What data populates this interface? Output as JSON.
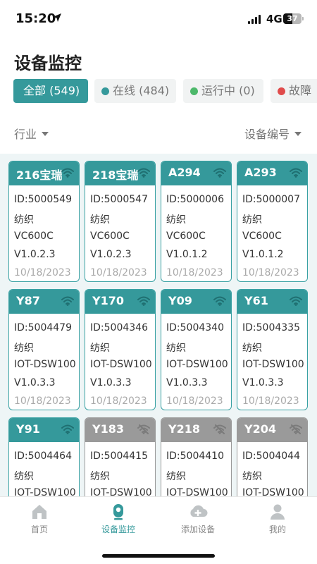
{
  "status_bar": {
    "time": "15:20",
    "network": "4G",
    "battery": "37"
  },
  "page_title": "设备监控",
  "filters": [
    {
      "label": "全部 (549)",
      "active": true,
      "dot_color": ""
    },
    {
      "label": "在线 (484)",
      "active": false,
      "dot_color": "#35999b"
    },
    {
      "label": "运行中 (0)",
      "active": false,
      "dot_color": "#4cb86a"
    },
    {
      "label": "故障",
      "active": false,
      "dot_color": "#e04b4b"
    }
  ],
  "sort": {
    "left_label": "行业",
    "right_label": "设备编号"
  },
  "devices": [
    {
      "name": "216宝瑞",
      "id": "ID:5000549",
      "industry": "纺织",
      "model": "VC600C",
      "version": "V1.0.2.3",
      "date": "10/18/2023",
      "online": true
    },
    {
      "name": "218宝瑞",
      "id": "ID:5000547",
      "industry": "纺织",
      "model": "VC600C",
      "version": "V1.0.2.3",
      "date": "10/18/2023",
      "online": true
    },
    {
      "name": "A294",
      "id": "ID:5000006",
      "industry": "纺织",
      "model": "VC600C",
      "version": "V1.0.1.2",
      "date": "10/18/2023",
      "online": true
    },
    {
      "name": "A293",
      "id": "ID:5000007",
      "industry": "纺织",
      "model": "VC600C",
      "version": "V1.0.1.2",
      "date": "10/18/2023",
      "online": true
    },
    {
      "name": "Y87",
      "id": "ID:5004479",
      "industry": "纺织",
      "model": "IOT-DSW100",
      "version": "V1.0.3.3",
      "date": "10/18/2023",
      "online": true
    },
    {
      "name": "Y170",
      "id": "ID:5004346",
      "industry": "纺织",
      "model": "IOT-DSW100",
      "version": "V1.0.3.3",
      "date": "10/18/2023",
      "online": true
    },
    {
      "name": "Y09",
      "id": "ID:5004340",
      "industry": "纺织",
      "model": "IOT-DSW100",
      "version": "V1.0.3.3",
      "date": "10/18/2023",
      "online": true
    },
    {
      "name": "Y61",
      "id": "ID:5004335",
      "industry": "纺织",
      "model": "IOT-DSW100",
      "version": "V1.0.3.3",
      "date": "10/18/2023",
      "online": true
    },
    {
      "name": "Y91",
      "id": "ID:5004464",
      "industry": "纺织",
      "model": "IOT-DSW100",
      "version": "",
      "date": "",
      "online": true
    },
    {
      "name": "Y183",
      "id": "ID:5004415",
      "industry": "纺织",
      "model": "IOT-DSW100",
      "version": "",
      "date": "",
      "online": false
    },
    {
      "name": "Y218",
      "id": "ID:5004410",
      "industry": "纺织",
      "model": "IOT-DSW100",
      "version": "",
      "date": "",
      "online": false
    },
    {
      "name": "Y204",
      "id": "ID:5004044",
      "industry": "纺织",
      "model": "IOT-DSW100",
      "version": "",
      "date": "",
      "online": false
    }
  ],
  "tabs": [
    {
      "label": "首页",
      "icon": "home-icon",
      "active": false
    },
    {
      "label": "设备监控",
      "icon": "monitor-icon",
      "active": true
    },
    {
      "label": "添加设备",
      "icon": "cloud-add-icon",
      "active": false
    },
    {
      "label": "我的",
      "icon": "user-icon",
      "active": false
    }
  ],
  "colors": {
    "accent": "#35999b",
    "offline": "#9a9a9a",
    "grid_bg": "#eef5f6"
  }
}
